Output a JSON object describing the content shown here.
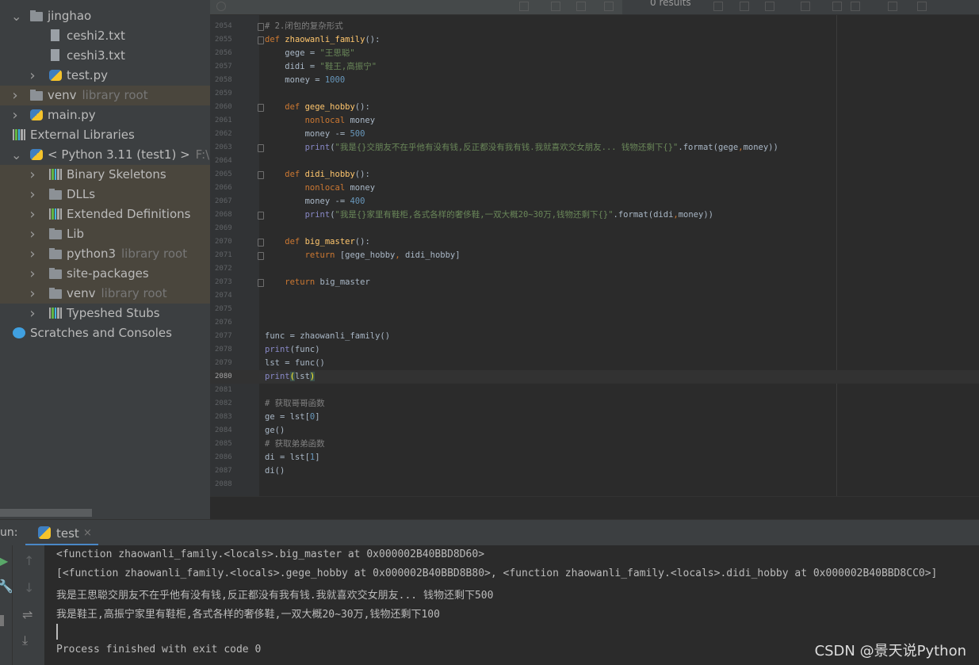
{
  "project_tree": [
    {
      "label": "jinghao",
      "hint": "",
      "icon": "folder",
      "depth": 1,
      "arrow": "expanded",
      "tint": false
    },
    {
      "label": "ceshi2.txt",
      "hint": "",
      "icon": "text-file",
      "depth": 2,
      "arrow": "none",
      "tint": false
    },
    {
      "label": "ceshi3.txt",
      "hint": "",
      "icon": "text-file",
      "depth": 2,
      "arrow": "none",
      "tint": false
    },
    {
      "label": "test.py",
      "hint": "",
      "icon": "python-file",
      "depth": 2,
      "arrow": "collapsed",
      "tint": false
    },
    {
      "label": "venv",
      "hint": "library root",
      "icon": "folder",
      "depth": 1,
      "arrow": "collapsed",
      "tint": true
    },
    {
      "label": "main.py",
      "hint": "",
      "icon": "python-file",
      "depth": 1,
      "arrow": "collapsed",
      "tint": false
    },
    {
      "label": "External Libraries",
      "hint": "",
      "icon": "libraries",
      "depth": 0,
      "arrow": "none",
      "tint": false
    },
    {
      "label": "< Python 3.11 (test1) >",
      "hint": "F:\\py",
      "icon": "python",
      "depth": 1,
      "arrow": "expanded",
      "tint": false
    },
    {
      "label": "Binary Skeletons",
      "hint": "",
      "icon": "libraries",
      "depth": 2,
      "arrow": "collapsed",
      "tint": true
    },
    {
      "label": "DLLs",
      "hint": "",
      "icon": "folder",
      "depth": 2,
      "arrow": "collapsed",
      "tint": true
    },
    {
      "label": "Extended Definitions",
      "hint": "",
      "icon": "libraries",
      "depth": 2,
      "arrow": "collapsed",
      "tint": true
    },
    {
      "label": "Lib",
      "hint": "",
      "icon": "folder",
      "depth": 2,
      "arrow": "collapsed",
      "tint": true
    },
    {
      "label": "python3",
      "hint": "library root",
      "icon": "folder",
      "depth": 2,
      "arrow": "collapsed",
      "tint": true
    },
    {
      "label": "site-packages",
      "hint": "",
      "icon": "folder",
      "depth": 2,
      "arrow": "collapsed",
      "tint": true
    },
    {
      "label": "venv",
      "hint": "library root",
      "icon": "folder",
      "depth": 2,
      "arrow": "collapsed",
      "tint": true
    },
    {
      "label": "Typeshed Stubs",
      "hint": "",
      "icon": "libraries",
      "depth": 2,
      "arrow": "collapsed",
      "tint": false
    },
    {
      "label": "Scratches and Consoles",
      "hint": "",
      "icon": "scratches",
      "depth": 0,
      "arrow": "none",
      "tint": false
    }
  ],
  "find_bar": {
    "results": "0 results"
  },
  "editor": {
    "current_line": 2080,
    "lines": [
      {
        "n": 2054,
        "fold": true,
        "t": [
          [
            "cm",
            "# 2.闭包的复杂形式"
          ]
        ]
      },
      {
        "n": 2055,
        "fold": true,
        "t": [
          [
            "kw",
            "def "
          ],
          [
            "fn",
            "zhaowanli_family"
          ],
          [
            "",
            "():"
          ]
        ]
      },
      {
        "n": 2056,
        "t": [
          [
            "",
            "    gege = "
          ],
          [
            "str",
            "\"王思聪\""
          ]
        ]
      },
      {
        "n": 2057,
        "t": [
          [
            "",
            "    didi = "
          ],
          [
            "str",
            "\"鞋王,高振宁\""
          ]
        ]
      },
      {
        "n": 2058,
        "t": [
          [
            "",
            "    money = "
          ],
          [
            "num",
            "1000"
          ]
        ]
      },
      {
        "n": 2059,
        "t": []
      },
      {
        "n": 2060,
        "fold": true,
        "t": [
          [
            "kw",
            "    def "
          ],
          [
            "fn",
            "gege_hobby"
          ],
          [
            "",
            "():"
          ]
        ]
      },
      {
        "n": 2061,
        "t": [
          [
            "kw",
            "        nonlocal "
          ],
          [
            "",
            "money"
          ]
        ]
      },
      {
        "n": 2062,
        "t": [
          [
            "",
            "        money -= "
          ],
          [
            "num",
            "500"
          ]
        ]
      },
      {
        "n": 2063,
        "fold": true,
        "t": [
          [
            "bi",
            "        print"
          ],
          [
            "",
            "("
          ],
          [
            "str",
            "\"我是{}交朋友不在乎他有没有钱,反正都没有我有钱.我就喜欢交女朋友... 钱物还剩下{}\""
          ],
          [
            "",
            ".format(gege"
          ],
          [
            "kw",
            ","
          ],
          [
            "",
            "money))"
          ]
        ]
      },
      {
        "n": 2064,
        "t": []
      },
      {
        "n": 2065,
        "fold": true,
        "t": [
          [
            "kw",
            "    def "
          ],
          [
            "fn",
            "didi_hobby"
          ],
          [
            "",
            "():"
          ]
        ]
      },
      {
        "n": 2066,
        "t": [
          [
            "kw",
            "        nonlocal "
          ],
          [
            "",
            "money"
          ]
        ]
      },
      {
        "n": 2067,
        "t": [
          [
            "",
            "        money -= "
          ],
          [
            "num",
            "400"
          ]
        ]
      },
      {
        "n": 2068,
        "fold": true,
        "t": [
          [
            "bi",
            "        print"
          ],
          [
            "",
            "("
          ],
          [
            "str",
            "\"我是{}家里有鞋柜,各式各样的奢侈鞋,一双大概20~30万,钱物还剩下{}\""
          ],
          [
            "",
            ".format(didi"
          ],
          [
            "kw",
            ","
          ],
          [
            "",
            "money))"
          ]
        ]
      },
      {
        "n": 2069,
        "t": []
      },
      {
        "n": 2070,
        "fold": true,
        "t": [
          [
            "kw",
            "    def "
          ],
          [
            "fn",
            "big_master"
          ],
          [
            "",
            "():"
          ]
        ]
      },
      {
        "n": 2071,
        "fold": true,
        "t": [
          [
            "kw",
            "        return "
          ],
          [
            "",
            "[gege_hobby"
          ],
          [
            "kw",
            ", "
          ],
          [
            "",
            "didi_hobby]"
          ]
        ]
      },
      {
        "n": 2072,
        "t": []
      },
      {
        "n": 2073,
        "fold": true,
        "t": [
          [
            "kw",
            "    return "
          ],
          [
            "",
            "big_master"
          ]
        ]
      },
      {
        "n": 2074,
        "t": []
      },
      {
        "n": 2075,
        "t": []
      },
      {
        "n": 2076,
        "t": []
      },
      {
        "n": 2077,
        "t": [
          [
            "",
            "func = zhaowanli_family()"
          ]
        ]
      },
      {
        "n": 2078,
        "t": [
          [
            "bi",
            "print"
          ],
          [
            "",
            "(func)"
          ]
        ]
      },
      {
        "n": 2079,
        "t": [
          [
            "",
            "lst = func()"
          ]
        ]
      },
      {
        "n": 2080,
        "t": [
          [
            "bi",
            "print"
          ],
          [
            "br",
            "("
          ],
          [
            "",
            "lst"
          ],
          [
            "br",
            ")"
          ]
        ]
      },
      {
        "n": 2081,
        "t": []
      },
      {
        "n": 2082,
        "t": [
          [
            "cm",
            "# 获取哥哥函数"
          ]
        ]
      },
      {
        "n": 2083,
        "t": [
          [
            "",
            "ge = lst["
          ],
          [
            "num",
            "0"
          ],
          [
            "",
            "]"
          ]
        ]
      },
      {
        "n": 2084,
        "t": [
          [
            "",
            "ge()"
          ]
        ]
      },
      {
        "n": 2085,
        "t": [
          [
            "cm",
            "# 获取弟弟函数"
          ]
        ]
      },
      {
        "n": 2086,
        "t": [
          [
            "",
            "di = lst["
          ],
          [
            "num",
            "1"
          ],
          [
            "",
            "]"
          ]
        ]
      },
      {
        "n": 2087,
        "t": [
          [
            "",
            "di()"
          ]
        ]
      },
      {
        "n": 2088,
        "t": []
      }
    ]
  },
  "run_panel": {
    "label": "un:",
    "tab": "test",
    "close": "×",
    "output": [
      "<function zhaowanli_family.<locals>.big_master at 0x000002B40BBD8D60>",
      "[<function zhaowanli_family.<locals>.gege_hobby at 0x000002B40BBD8B80>, <function zhaowanli_family.<locals>.didi_hobby at 0x000002B40BBD8CC0>]",
      "我是王思聪交朋友不在乎他有没有钱,反正都没有我有钱.我就喜欢交女朋友... 钱物还剩下500",
      "我是鞋王,高振宁家里有鞋柜,各式各样的奢侈鞋,一双大概20~30万,钱物还剩下100"
    ],
    "finish": "Process finished with exit code 0"
  },
  "watermark": "CSDN @景天说Python",
  "colors": {
    "keyword": "#cc7832",
    "string": "#6a8759",
    "number": "#6897bb",
    "builtin": "#8888c6",
    "function": "#ffc66d",
    "comment": "#808080",
    "accent": "#4a88c7"
  }
}
